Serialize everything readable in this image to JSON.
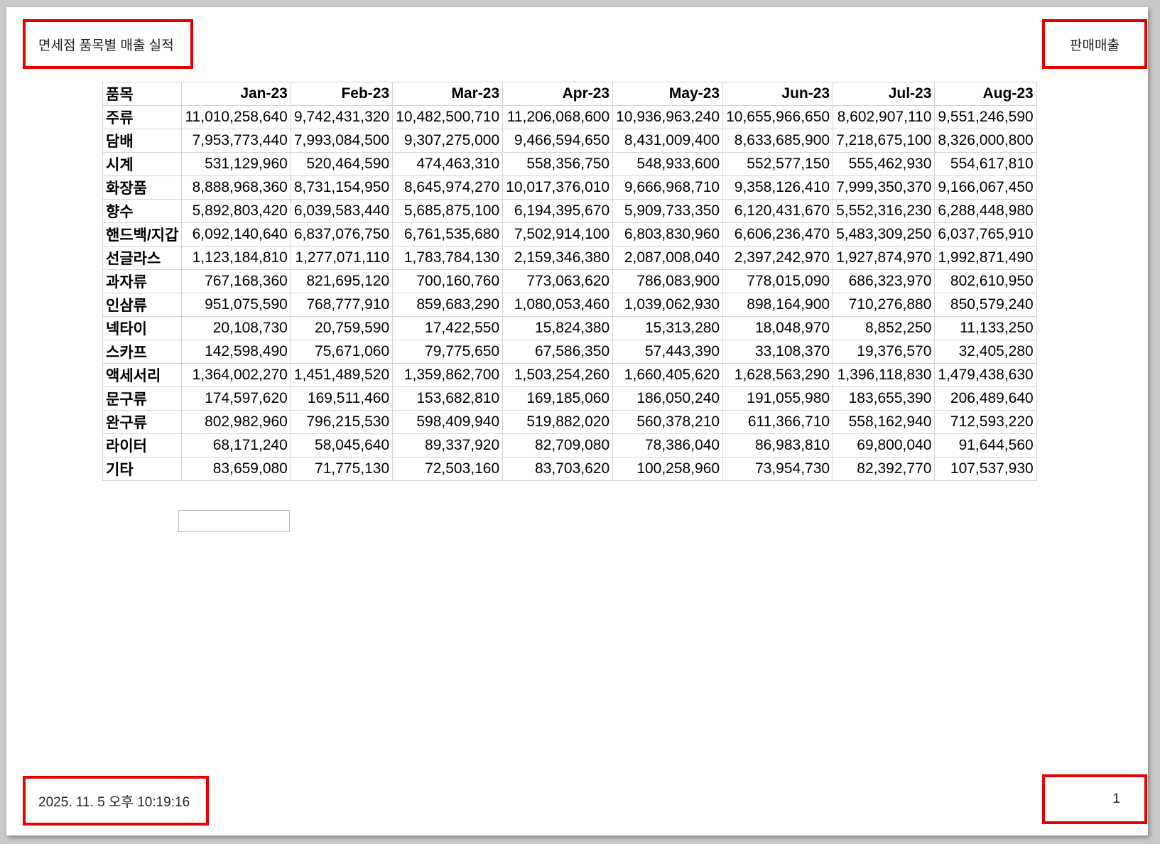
{
  "header": {
    "title": "면세점 품목별 매출 실적",
    "sheet_name": "판매매출"
  },
  "footer": {
    "timestamp": "2025. 11. 5 오후 10:19:16",
    "page_number": "1"
  },
  "table": {
    "columns": [
      "품목",
      "Jan-23",
      "Feb-23",
      "Mar-23",
      "Apr-23",
      "May-23",
      "Jun-23",
      "Jul-23",
      "Aug-23"
    ],
    "rows": [
      {
        "category": "주류",
        "values": [
          "11,010,258,640",
          "9,742,431,320",
          "10,482,500,710",
          "11,206,068,600",
          "10,936,963,240",
          "10,655,966,650",
          "8,602,907,110",
          "9,551,246,590"
        ]
      },
      {
        "category": "담배",
        "values": [
          "7,953,773,440",
          "7,993,084,500",
          "9,307,275,000",
          "9,466,594,650",
          "8,431,009,400",
          "8,633,685,900",
          "7,218,675,100",
          "8,326,000,800"
        ]
      },
      {
        "category": "시계",
        "values": [
          "531,129,960",
          "520,464,590",
          "474,463,310",
          "558,356,750",
          "548,933,600",
          "552,577,150",
          "555,462,930",
          "554,617,810"
        ]
      },
      {
        "category": "화장품",
        "values": [
          "8,888,968,360",
          "8,731,154,950",
          "8,645,974,270",
          "10,017,376,010",
          "9,666,968,710",
          "9,358,126,410",
          "7,999,350,370",
          "9,166,067,450"
        ]
      },
      {
        "category": "향수",
        "values": [
          "5,892,803,420",
          "6,039,583,440",
          "5,685,875,100",
          "6,194,395,670",
          "5,909,733,350",
          "6,120,431,670",
          "5,552,316,230",
          "6,288,448,980"
        ]
      },
      {
        "category": "핸드백/지갑",
        "values": [
          "6,092,140,640",
          "6,837,076,750",
          "6,761,535,680",
          "7,502,914,100",
          "6,803,830,960",
          "6,606,236,470",
          "5,483,309,250",
          "6,037,765,910"
        ]
      },
      {
        "category": "선글라스",
        "values": [
          "1,123,184,810",
          "1,277,071,110",
          "1,783,784,130",
          "2,159,346,380",
          "2,087,008,040",
          "2,397,242,970",
          "1,927,874,970",
          "1,992,871,490"
        ]
      },
      {
        "category": "과자류",
        "values": [
          "767,168,360",
          "821,695,120",
          "700,160,760",
          "773,063,620",
          "786,083,900",
          "778,015,090",
          "686,323,970",
          "802,610,950"
        ]
      },
      {
        "category": "인삼류",
        "values": [
          "951,075,590",
          "768,777,910",
          "859,683,290",
          "1,080,053,460",
          "1,039,062,930",
          "898,164,900",
          "710,276,880",
          "850,579,240"
        ]
      },
      {
        "category": "넥타이",
        "values": [
          "20,108,730",
          "20,759,590",
          "17,422,550",
          "15,824,380",
          "15,313,280",
          "18,048,970",
          "8,852,250",
          "11,133,250"
        ]
      },
      {
        "category": "스카프",
        "values": [
          "142,598,490",
          "75,671,060",
          "79,775,650",
          "67,586,350",
          "57,443,390",
          "33,108,370",
          "19,376,570",
          "32,405,280"
        ]
      },
      {
        "category": "액세서리",
        "values": [
          "1,364,002,270",
          "1,451,489,520",
          "1,359,862,700",
          "1,503,254,260",
          "1,660,405,620",
          "1,628,563,290",
          "1,396,118,830",
          "1,479,438,630"
        ]
      },
      {
        "category": "문구류",
        "values": [
          "174,597,620",
          "169,511,460",
          "153,682,810",
          "169,185,060",
          "186,050,240",
          "191,055,980",
          "183,655,390",
          "206,489,640"
        ]
      },
      {
        "category": "완구류",
        "values": [
          "802,982,960",
          "796,215,530",
          "598,409,940",
          "519,882,020",
          "560,378,210",
          "611,366,710",
          "558,162,940",
          "712,593,220"
        ]
      },
      {
        "category": "라이터",
        "values": [
          "68,171,240",
          "58,045,640",
          "89,337,920",
          "82,709,080",
          "78,386,040",
          "86,983,810",
          "69,800,040",
          "91,644,560"
        ]
      },
      {
        "category": "기타",
        "values": [
          "83,659,080",
          "71,775,130",
          "72,503,160",
          "83,703,620",
          "100,258,960",
          "73,954,730",
          "82,392,770",
          "107,537,930"
        ]
      }
    ]
  },
  "colors": {
    "highlight_box": "#e60000",
    "grid_line": "#d4d4d4"
  }
}
